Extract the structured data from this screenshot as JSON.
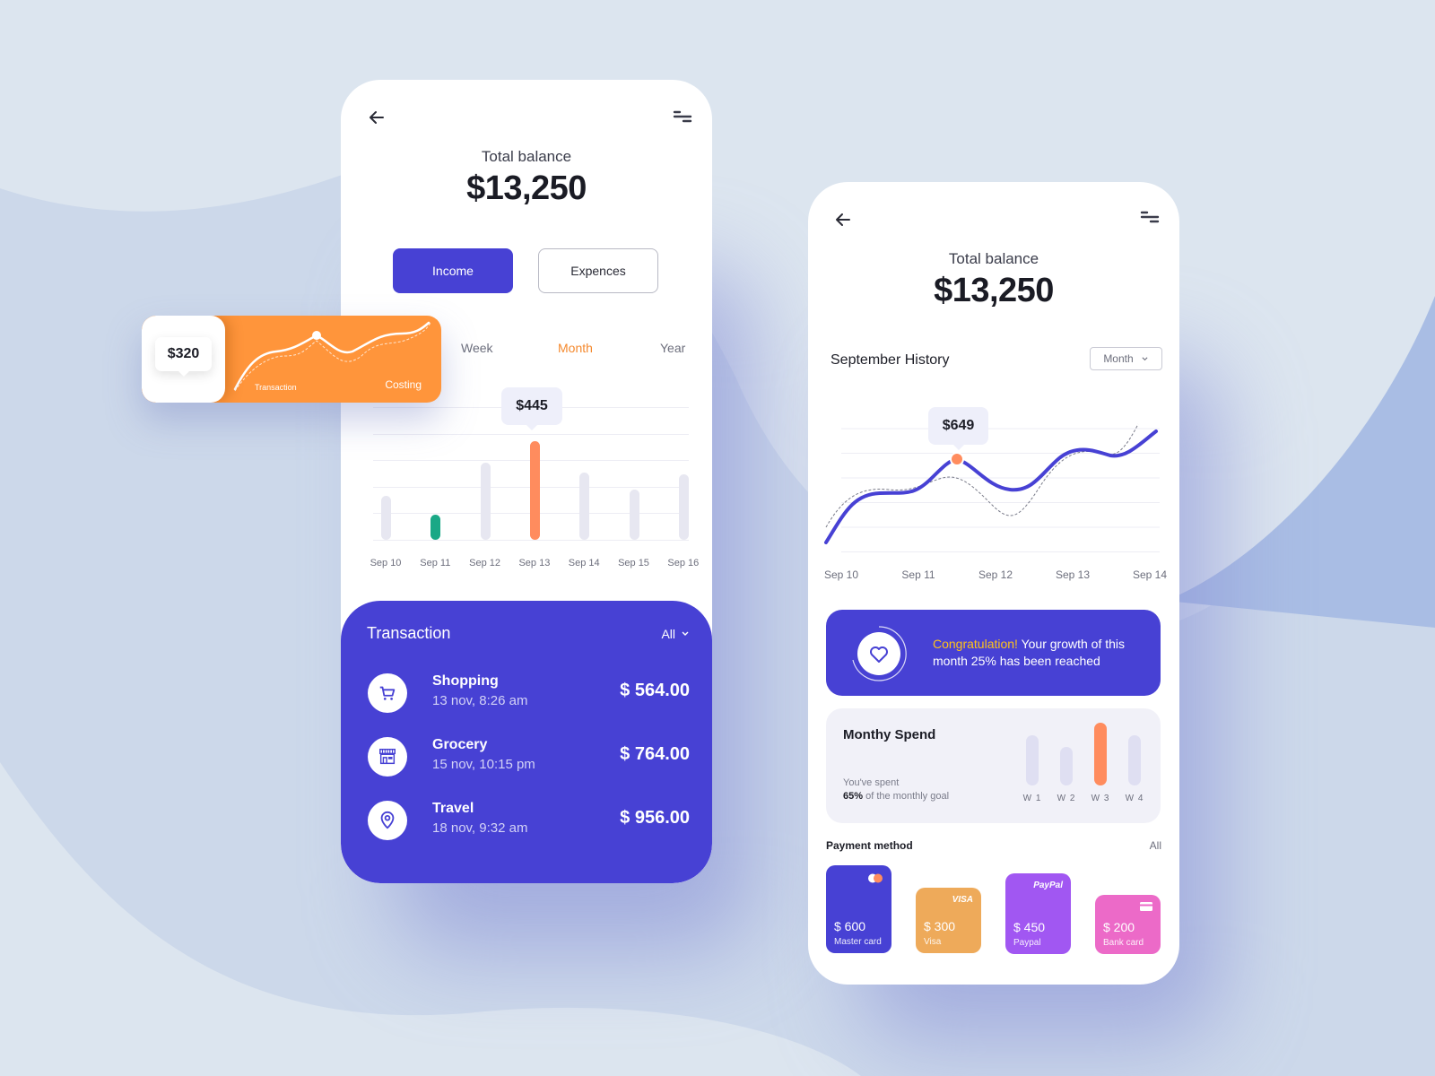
{
  "colors": {
    "primary": "#4741d4",
    "accent_orange": "#ff8c5e",
    "accent_green": "#1aa886",
    "tab_active": "#f4892e",
    "bar_inactive": "#e7e7f1",
    "congrats_highlight": "#ffc21a"
  },
  "phone1": {
    "back_icon": "arrow-left-icon",
    "menu_icon": "filter-lines-icon",
    "balance_label": "Total balance",
    "balance_value": "$13,250",
    "buttons": {
      "income": "Income",
      "expenses": "Expences",
      "selected": "income"
    },
    "period_tabs": [
      {
        "label": "Week",
        "active": false
      },
      {
        "label": "Month",
        "active": true
      },
      {
        "label": "Year",
        "active": false
      }
    ],
    "bar_chart": {
      "tooltip": "$445",
      "categories": [
        "Sep 10",
        "Sep 11",
        "Sep 12",
        "Sep 13",
        "Sep 14",
        "Sep 15",
        "Sep 16"
      ],
      "values": [
        0.33,
        0.19,
        0.58,
        0.74,
        0.51,
        0.38,
        0.49
      ],
      "highlight": [
        null,
        "green",
        null,
        "orange",
        null,
        null,
        null
      ]
    },
    "transactions": {
      "title": "Transaction",
      "filter_label": "All",
      "items": [
        {
          "icon": "shopping-cart-icon",
          "name": "Shopping",
          "date": "13 nov, 8:26 am",
          "amount": "$ 564.00"
        },
        {
          "icon": "store-icon",
          "name": "Grocery",
          "date": "15 nov, 10:15 pm",
          "amount": "$ 764.00"
        },
        {
          "icon": "location-pin-icon",
          "name": "Travel",
          "date": "18 nov, 9:32 am",
          "amount": "$ 956.00"
        }
      ]
    }
  },
  "floating_card": {
    "tooltip": "$320",
    "label_left": "Transaction",
    "label_right": "Costing"
  },
  "phone2": {
    "back_icon": "arrow-left-icon",
    "menu_icon": "filter-lines-icon",
    "balance_label": "Total balance",
    "balance_value": "$13,250",
    "history_title": "September History",
    "period_select": "Month",
    "line_chart": {
      "tooltip": "$649",
      "categories": [
        "Sep 10",
        "Sep 11",
        "Sep 12",
        "Sep 13",
        "Sep 14"
      ]
    },
    "congrats": {
      "highlight": "Congratulation!",
      "message": " Your growth of this month 25% has been reached",
      "icon": "heart-icon"
    },
    "monthly_spend": {
      "title": "Monthy Spend",
      "line1": "You've spent",
      "percent": "65%",
      "line2": " of the monthly goal",
      "weeks": [
        {
          "label": "W 1",
          "value": 0.62,
          "highlight": false
        },
        {
          "label": "W 2",
          "value": 0.48,
          "highlight": false
        },
        {
          "label": "W 3",
          "value": 0.78,
          "highlight": true
        },
        {
          "label": "W 4",
          "value": 0.62,
          "highlight": false
        }
      ]
    },
    "payment": {
      "title": "Payment method",
      "all_label": "All",
      "cards": [
        {
          "amount": "$ 600",
          "name": "Master card",
          "logo": "mastercard-icon",
          "logo_text": "",
          "color": "#4741d4"
        },
        {
          "amount": "$ 300",
          "name": "Visa",
          "logo": "visa-logo",
          "logo_text": "VISA",
          "color": "#eeaa5a"
        },
        {
          "amount": "$ 450",
          "name": "Paypal",
          "logo": "paypal-logo",
          "logo_text": "PayPal",
          "color": "#a157f2"
        },
        {
          "amount": "$ 200",
          "name": "Bank card",
          "logo": "credit-card-icon",
          "logo_text": "",
          "color": "#ec6ac8"
        }
      ]
    }
  }
}
